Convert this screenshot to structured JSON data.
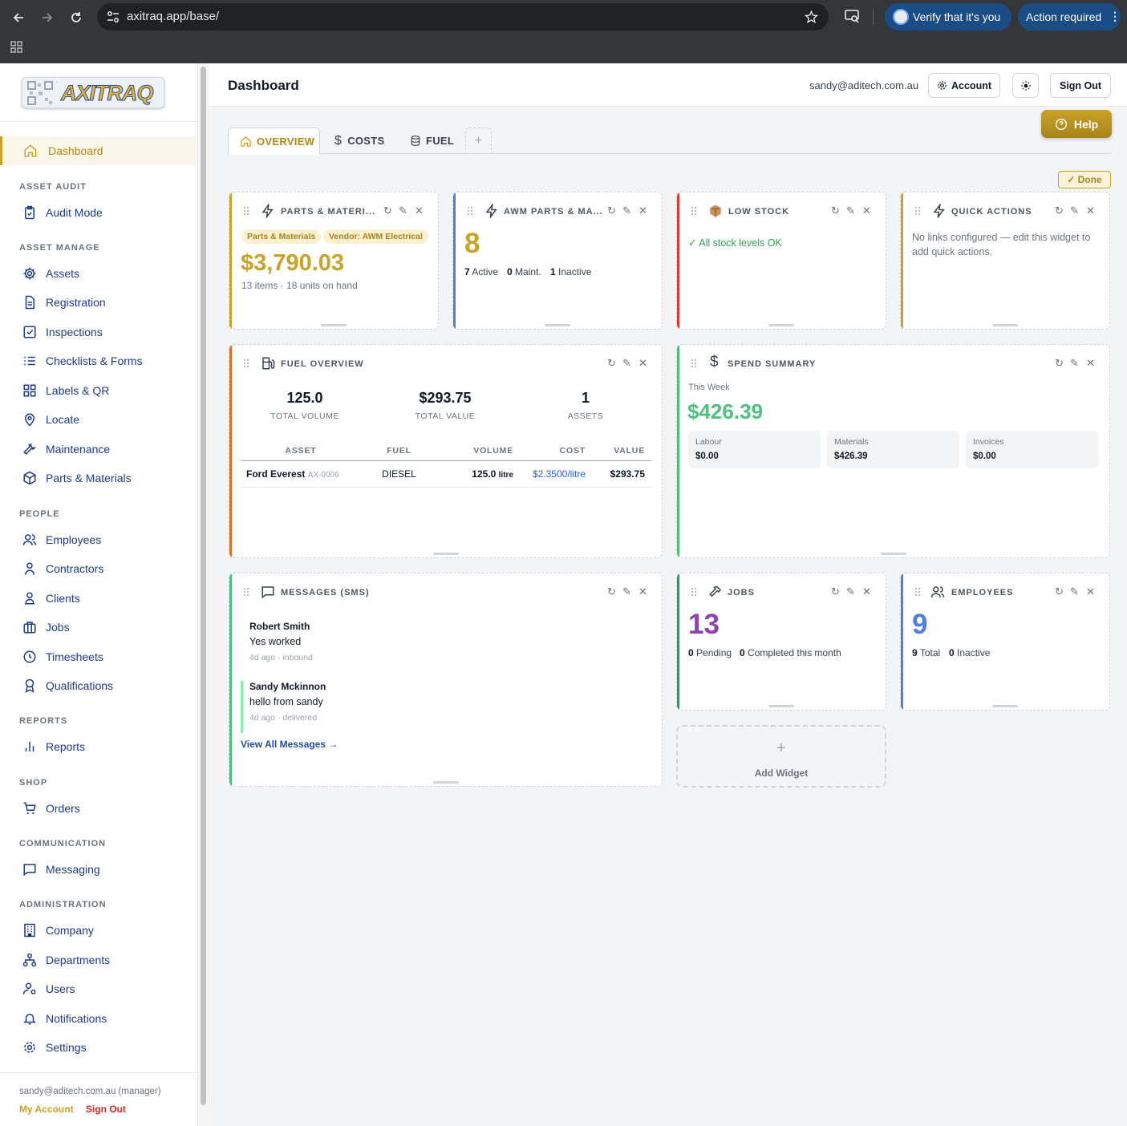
{
  "browser": {
    "url": "axitraq.app/base/",
    "verify_label": "Verify that it's you",
    "action_label": "Action required"
  },
  "logo": {
    "text": "AXITRAQ"
  },
  "sidebar": {
    "dashboard": "Dashboard",
    "sections": {
      "asset_audit": "ASSET AUDIT",
      "asset_manage": "ASSET MANAGE",
      "people": "PEOPLE",
      "reports": "REPORTS",
      "shop": "SHOP",
      "communication": "COMMUNICATION",
      "administration": "ADMINISTRATION"
    },
    "items": {
      "audit_mode": "Audit Mode",
      "assets": "Assets",
      "registration": "Registration",
      "inspections": "Inspections",
      "checklists": "Checklists & Forms",
      "labels": "Labels & QR",
      "locate": "Locate",
      "maintenance": "Maintenance",
      "parts": "Parts & Materials",
      "employees": "Employees",
      "contractors": "Contractors",
      "clients": "Clients",
      "jobs": "Jobs",
      "timesheets": "Timesheets",
      "qualifications": "Qualifications",
      "reports": "Reports",
      "orders": "Orders",
      "messaging": "Messaging",
      "company": "Company",
      "departments": "Departments",
      "users": "Users",
      "notifications": "Notifications",
      "settings": "Settings"
    },
    "footer": {
      "email": "sandy@aditech.com.au (manager)",
      "my_account": "My Account",
      "sign_out": "Sign Out"
    }
  },
  "header": {
    "title": "Dashboard",
    "email": "sandy@aditech.com.au",
    "account": "Account",
    "sign_out": "Sign Out",
    "help": "Help"
  },
  "tabs": {
    "overview": "OVERVIEW",
    "costs": "COSTS",
    "fuel": "FUEL",
    "add": "+"
  },
  "done_label": "✓ Done",
  "controls": {
    "refresh": "↻",
    "edit": "✎",
    "close": "✕"
  },
  "widgets": {
    "parts": {
      "title": "PARTS & MATERI...",
      "tag1": "Parts & Materials",
      "tag2": "Vendor: AWM Electrical",
      "value": "$3,790.03",
      "sub": "13 items · 18 units on hand"
    },
    "awm": {
      "title": "AWM PARTS & MA...",
      "count": "8",
      "active_n": "7",
      "active_l": "Active",
      "maint_n": "0",
      "maint_l": "Maint.",
      "inactive_n": "1",
      "inactive_l": "Inactive"
    },
    "low_stock": {
      "title": "LOW STOCK",
      "status": "✓ All stock levels OK"
    },
    "quick": {
      "title": "QUICK ACTIONS",
      "text": "No links configured — edit this widget to add quick actions."
    },
    "fuel": {
      "title": "FUEL OVERVIEW",
      "vol": "125.0",
      "vol_l": "TOTAL VOLUME",
      "val": "$293.75",
      "val_l": "TOTAL VALUE",
      "assets": "1",
      "assets_l": "ASSETS",
      "cols": [
        "ASSET",
        "FUEL",
        "VOLUME",
        "COST",
        "VALUE"
      ],
      "row": {
        "asset": "Ford Everest",
        "code": "AX-0006",
        "fuel": "DIESEL",
        "volume": "125.0",
        "unit": "litre",
        "cost": "$2.3500/litre",
        "value": "$293.75"
      }
    },
    "spend": {
      "title": "SPEND SUMMARY",
      "period": "This Week",
      "total": "$426.39",
      "labour_l": "Labour",
      "labour_v": "$0.00",
      "materials_l": "Materials",
      "materials_v": "$426.39",
      "invoices_l": "Invoices",
      "invoices_v": "$0.00"
    },
    "messages": {
      "title": "MESSAGES (SMS)",
      "m1": {
        "name": "Robert Smith",
        "text": "Yes worked",
        "meta": "4d ago · inbound"
      },
      "m2": {
        "name": "Sandy Mckinnon",
        "text": "hello from sandy",
        "meta": "4d ago · delivered"
      },
      "view_all": "View All Messages →"
    },
    "jobs": {
      "title": "JOBS",
      "count": "13",
      "pending_n": "0",
      "pending_l": "Pending",
      "completed_n": "0",
      "completed_l": "Completed this month"
    },
    "employees": {
      "title": "EMPLOYEES",
      "count": "9",
      "total_n": "9",
      "total_l": "Total",
      "inactive_n": "0",
      "inactive_l": "Inactive"
    },
    "add": {
      "plus": "+",
      "label": "Add Widget"
    }
  },
  "colors": {
    "gold": "#c9a227",
    "blue": "#4f7fd9",
    "red": "#dc3b2f",
    "orange": "#e26d2a",
    "green": "#4fbf7f",
    "purple": "#8e44ad"
  }
}
